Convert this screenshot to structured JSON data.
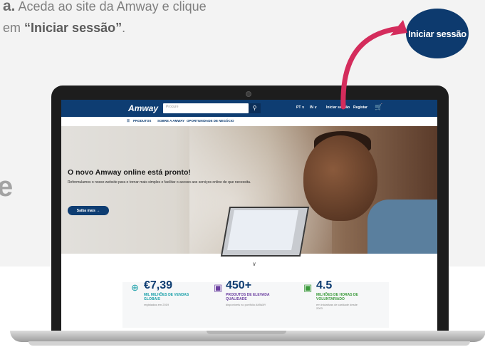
{
  "instruction": {
    "step": "a.",
    "line1": "Aceda ao site da Amway e clique",
    "line2_prefix": "em",
    "line2_quoted": "“Iniciar sessão”",
    "line2_suffix": "."
  },
  "cut_letter": "e",
  "bubble": {
    "label": "Iniciar sessão"
  },
  "colors": {
    "navy": "#0e3d72",
    "arrow": "#d42c5c",
    "stat_teal": "#1aa0a9",
    "stat_purple": "#6b3fa0",
    "stat_green": "#3a9a3a"
  },
  "site": {
    "logo": "Amway",
    "search_placeholder": "Procure",
    "search_icon": "search-icon",
    "lang_pt": "PT",
    "lang_ini": "IN",
    "login": "Iniciar sessão",
    "register": "Registar",
    "cart_icon": "cart-icon",
    "nav": [
      "PRODUTOS",
      "SOBRE A AMWAY",
      "OPORTUNIDADE DE NEGÓCIO"
    ],
    "hero": {
      "title": "O novo Amway online está pronto!",
      "text": "Reformulamos o nosso website para o tornar mais simples e facilitar o acesso aos serviços online de que necessita.",
      "button": "Saiba mais →"
    },
    "stats": [
      {
        "value": "€7,39",
        "label1": "MIL MILHÕES DE VENDAS",
        "label2": "GLOBAIS",
        "sub": "registadas em 2019"
      },
      {
        "value": "450+",
        "label1": "PRODUTOS DE ELEVADA",
        "label2": "QUALIDADE",
        "sub": "disponíveis no portfólio AMWAY"
      },
      {
        "value": "4.5",
        "label1": "MILHÕES DE HORAS DE",
        "label2": "VOLUNTARIADO",
        "sub": "em iniciativas de caridade desde",
        "sub2": "2003"
      }
    ]
  }
}
